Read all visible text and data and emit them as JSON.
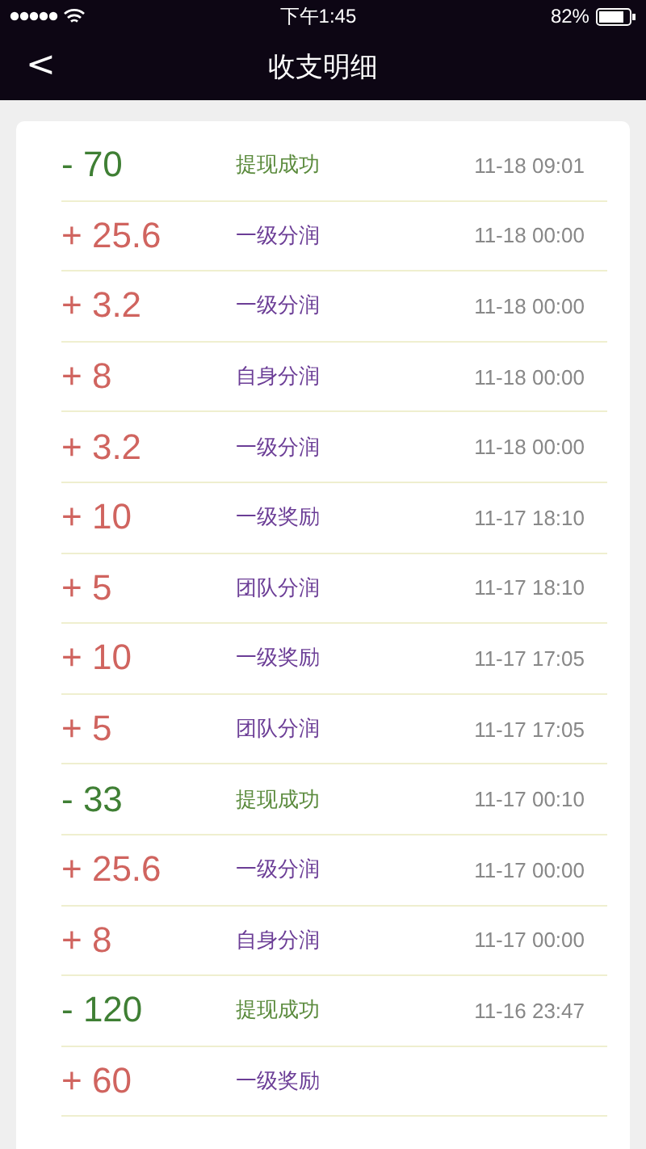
{
  "status_bar": {
    "time": "下午1:45",
    "battery": "82%"
  },
  "nav": {
    "back": "<",
    "title": "收支明细"
  },
  "records": [
    {
      "kind": "withdraw",
      "amount": "- 70",
      "category": "提现成功",
      "time": "11-18 09:01"
    },
    {
      "kind": "income",
      "amount": "+ 25.6",
      "category": "一级分润",
      "time": "11-18 00:00"
    },
    {
      "kind": "income",
      "amount": "+ 3.2",
      "category": "一级分润",
      "time": "11-18 00:00"
    },
    {
      "kind": "income",
      "amount": "+ 8",
      "category": "自身分润",
      "time": "11-18 00:00"
    },
    {
      "kind": "income",
      "amount": "+ 3.2",
      "category": "一级分润",
      "time": "11-18 00:00"
    },
    {
      "kind": "income",
      "amount": "+ 10",
      "category": "一级奖励",
      "time": "11-17 18:10"
    },
    {
      "kind": "income",
      "amount": "+ 5",
      "category": "团队分润",
      "time": "11-17 18:10"
    },
    {
      "kind": "income",
      "amount": "+ 10",
      "category": "一级奖励",
      "time": "11-17 17:05"
    },
    {
      "kind": "income",
      "amount": "+ 5",
      "category": "团队分润",
      "time": "11-17 17:05"
    },
    {
      "kind": "withdraw",
      "amount": "- 33",
      "category": "提现成功",
      "time": "11-17 00:10"
    },
    {
      "kind": "income",
      "amount": "+ 25.6",
      "category": "一级分润",
      "time": "11-17 00:00"
    },
    {
      "kind": "income",
      "amount": "+ 8",
      "category": "自身分润",
      "time": "11-17 00:00"
    },
    {
      "kind": "withdraw",
      "amount": "- 120",
      "category": "提现成功",
      "time": "11-16 23:47"
    },
    {
      "kind": "income",
      "amount": "+ 60",
      "category": "一级奖励"
    }
  ]
}
